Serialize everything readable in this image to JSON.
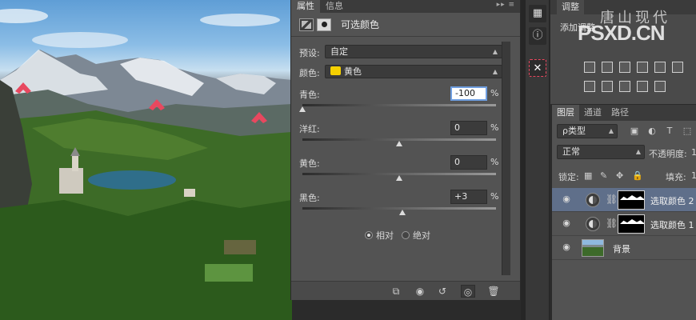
{
  "properties_panel": {
    "tabs": [
      {
        "label": "属性",
        "active": true
      },
      {
        "label": "信息",
        "active": false
      }
    ],
    "menu_glyph": "▸▸ ≡",
    "title": "可选颜色",
    "preset": {
      "label": "预设:",
      "value": "自定"
    },
    "colors": {
      "label": "颜色:",
      "value": "黄色",
      "swatch": "#f5d000"
    },
    "sliders": [
      {
        "label": "青色:",
        "value": "-100",
        "unit": "%",
        "active": true,
        "thumb_fraction": 0.0
      },
      {
        "label": "洋红:",
        "value": "0",
        "unit": "%",
        "active": false,
        "thumb_fraction": 0.5
      },
      {
        "label": "黄色:",
        "value": "0",
        "unit": "%",
        "active": false,
        "thumb_fraction": 0.5
      },
      {
        "label": "黑色:",
        "value": "+3",
        "unit": "%",
        "active": false,
        "thumb_fraction": 0.515
      }
    ],
    "method": {
      "relative_label": "相对",
      "absolute_label": "绝对",
      "selected": "relative"
    }
  },
  "adjustments_panel": {
    "tab": "调整",
    "subtitle": "添加调整",
    "watermark_top": "唐山现代",
    "watermark_bottom": "PSXD.CN"
  },
  "layers_panel": {
    "tabs": [
      {
        "label": "图层",
        "active": true
      },
      {
        "label": "通道",
        "active": false
      },
      {
        "label": "路径",
        "active": false
      }
    ],
    "filter": {
      "value": "ρ类型"
    },
    "blend_mode": {
      "value": "正常"
    },
    "opacity_label": "不透明度:",
    "opacity_value": "1",
    "lock_label": "锁定:",
    "fill_label": "填充:",
    "fill_value": "1",
    "layers": [
      {
        "name": "选取颜色 2",
        "type": "adjustment",
        "selected": true
      },
      {
        "name": "选取颜色 1",
        "type": "adjustment",
        "selected": false
      },
      {
        "name": "背景",
        "type": "background",
        "selected": false
      }
    ]
  },
  "colors": {
    "accent_selection": "#5f6f8a",
    "marker_pink": "#e8485f",
    "panel_bg": "#535353"
  }
}
